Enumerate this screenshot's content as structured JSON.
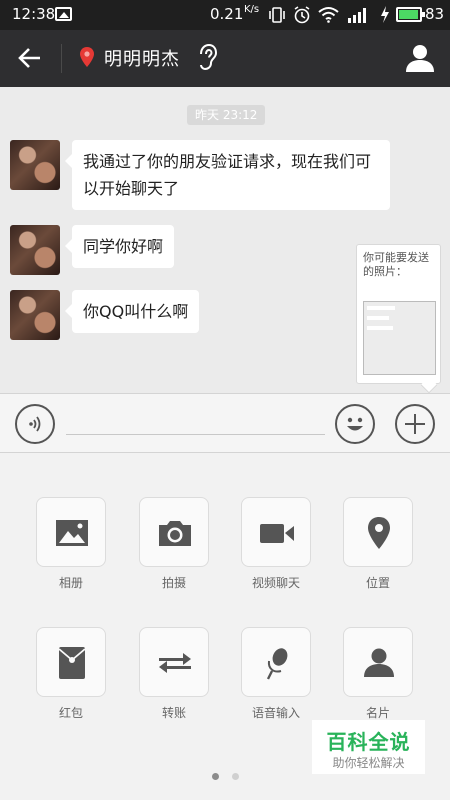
{
  "status_bar": {
    "time": "12:38",
    "net_speed": "0.21",
    "net_speed_unit": "K/s",
    "battery": "83",
    "icons": [
      "image-icon",
      "vibrate-icon",
      "alarm-icon",
      "wifi-icon",
      "signal-icon",
      "charging-icon",
      "battery-icon"
    ]
  },
  "header": {
    "contact_name": "明明明杰",
    "icons": [
      "back-arrow-icon",
      "location-pin-icon",
      "earpiece-icon",
      "contact-profile-icon"
    ],
    "pin_color": "#e53935"
  },
  "chat": {
    "timestamp": "昨天 23:12",
    "messages": [
      {
        "text": "我通过了你的朋友验证请求，现在我们可以开始聊天了"
      },
      {
        "text": "同学你好啊"
      },
      {
        "text": "你QQ叫什么啊"
      }
    ],
    "suggestion": {
      "text": "你可能要发送的照片："
    }
  },
  "input_bar": {
    "placeholder": "",
    "icons": [
      "voice-icon",
      "emoji-icon",
      "plus-icon"
    ]
  },
  "actions": [
    {
      "label": "相册",
      "icon": "album-icon"
    },
    {
      "label": "拍摄",
      "icon": "camera-icon"
    },
    {
      "label": "视频聊天",
      "icon": "video-call-icon"
    },
    {
      "label": "位置",
      "icon": "location-icon"
    },
    {
      "label": "红包",
      "icon": "red-packet-icon"
    },
    {
      "label": "转账",
      "icon": "transfer-icon"
    },
    {
      "label": "语音输入",
      "icon": "microphone-icon"
    },
    {
      "label": "名片",
      "icon": "contact-card-icon"
    }
  ],
  "pager": {
    "current_page": 1,
    "total_pages": 2
  },
  "watermark": {
    "title": "百科全说",
    "subtitle": "助你轻松解决"
  },
  "colors": {
    "header_bg": "#2e2e30",
    "chat_bg": "#ebebeb",
    "icon_gray": "#666666",
    "watermark_green": "#29b35a"
  }
}
